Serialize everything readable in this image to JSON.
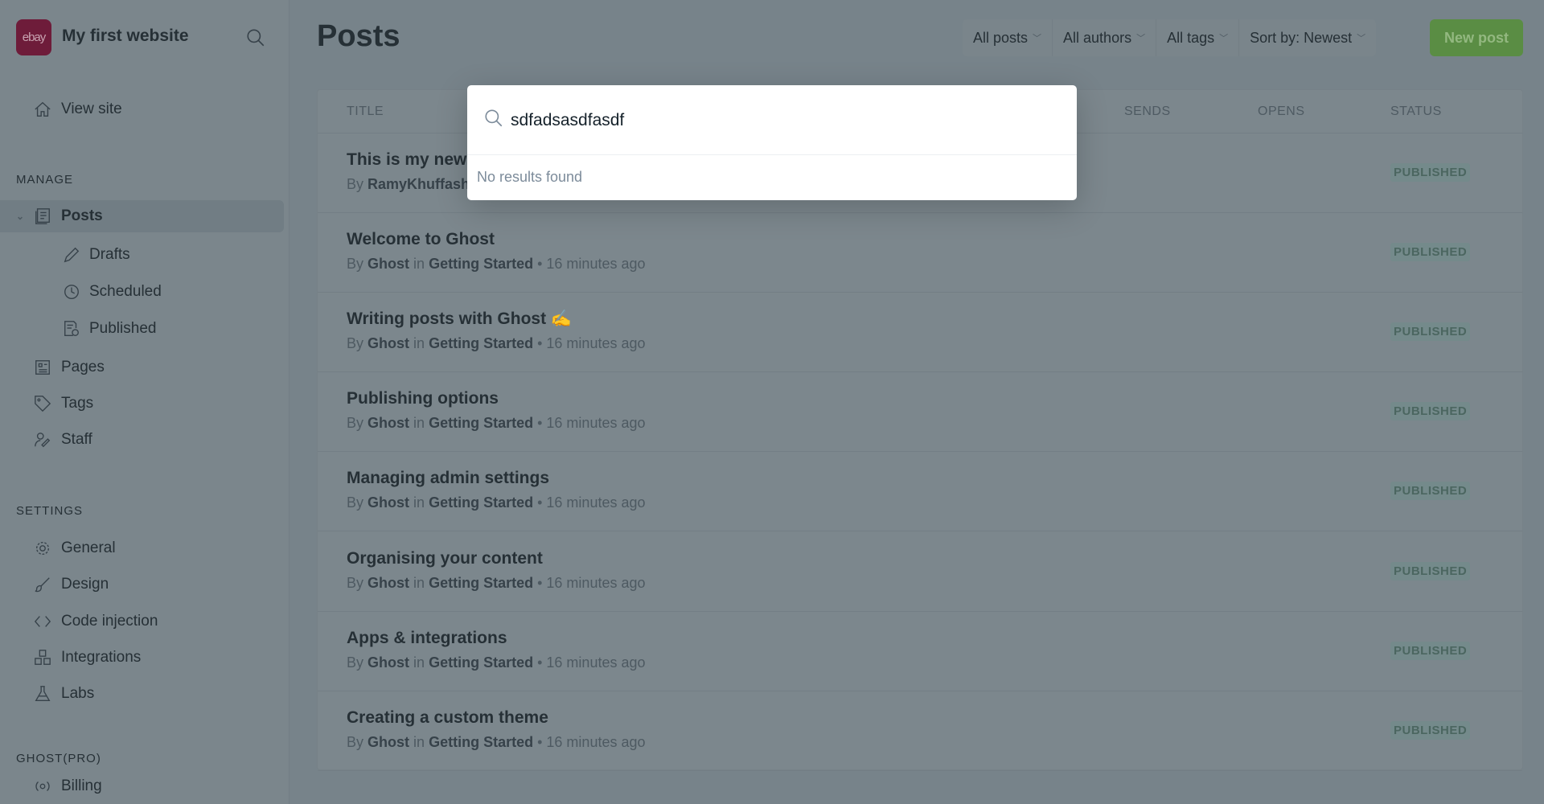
{
  "sidebar": {
    "logo_text": "ebay",
    "site_title": "My first website",
    "view_site": "View site",
    "manage_label": "MANAGE",
    "manage": [
      {
        "label": "Posts",
        "icon": "posts-icon"
      },
      {
        "label": "Drafts",
        "icon": "pencil-icon"
      },
      {
        "label": "Scheduled",
        "icon": "clock-icon"
      },
      {
        "label": "Published",
        "icon": "published-icon"
      },
      {
        "label": "Pages",
        "icon": "pages-icon"
      },
      {
        "label": "Tags",
        "icon": "tag-icon"
      },
      {
        "label": "Staff",
        "icon": "staff-icon"
      }
    ],
    "settings_label": "SETTINGS",
    "settings": [
      {
        "label": "General",
        "icon": "gear-icon"
      },
      {
        "label": "Design",
        "icon": "brush-icon"
      },
      {
        "label": "Code injection",
        "icon": "code-icon"
      },
      {
        "label": "Integrations",
        "icon": "integrations-icon"
      },
      {
        "label": "Labs",
        "icon": "flask-icon"
      }
    ],
    "ghostpro_label": "GHOST(PRO)",
    "billing": "Billing"
  },
  "header": {
    "title": "Posts",
    "filters": [
      "All posts",
      "All authors",
      "All tags",
      "Sort by: Newest"
    ],
    "new_post": "New post"
  },
  "table": {
    "columns": [
      "TITLE",
      "SENDS",
      "OPENS",
      "STATUS"
    ],
    "rows": [
      {
        "title": "This is my new",
        "by": "By",
        "author": "RamyKhuffash",
        "in": "",
        "tag": "",
        "time": "",
        "status": "PUBLISHED"
      },
      {
        "title": "Welcome to Ghost",
        "by": "By",
        "author": "Ghost",
        "in": "in",
        "tag": "Getting Started",
        "time": "• 16 minutes ago",
        "status": "PUBLISHED"
      },
      {
        "title": "Writing posts with Ghost ✍️",
        "by": "By",
        "author": "Ghost",
        "in": "in",
        "tag": "Getting Started",
        "time": "• 16 minutes ago",
        "status": "PUBLISHED"
      },
      {
        "title": "Publishing options",
        "by": "By",
        "author": "Ghost",
        "in": "in",
        "tag": "Getting Started",
        "time": "• 16 minutes ago",
        "status": "PUBLISHED"
      },
      {
        "title": "Managing admin settings",
        "by": "By",
        "author": "Ghost",
        "in": "in",
        "tag": "Getting Started",
        "time": "• 16 minutes ago",
        "status": "PUBLISHED"
      },
      {
        "title": "Organising your content",
        "by": "By",
        "author": "Ghost",
        "in": "in",
        "tag": "Getting Started",
        "time": "• 16 minutes ago",
        "status": "PUBLISHED"
      },
      {
        "title": "Apps & integrations",
        "by": "By",
        "author": "Ghost",
        "in": "in",
        "tag": "Getting Started",
        "time": "• 16 minutes ago",
        "status": "PUBLISHED"
      },
      {
        "title": "Creating a custom theme",
        "by": "By",
        "author": "Ghost",
        "in": "in",
        "tag": "Getting Started",
        "time": "• 16 minutes ago",
        "status": "PUBLISHED"
      }
    ]
  },
  "search_modal": {
    "query": "sdfadsasdfasdf",
    "empty_text": "No results found"
  },
  "colors": {
    "brand": "#c3144f",
    "accent_green": "#30cf43",
    "overlay": "rgba(15,35,46,0.55)"
  }
}
